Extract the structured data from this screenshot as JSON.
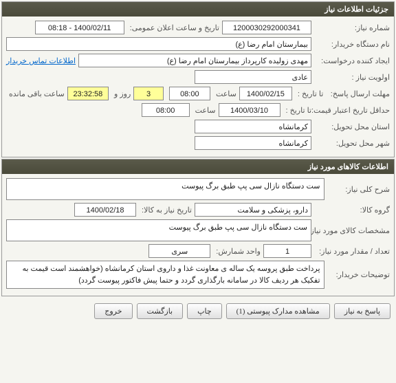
{
  "panel1": {
    "title": "جزئیات اطلاعات نیاز"
  },
  "need": {
    "number_label": "شماره نیاز:",
    "number": "1200030292000341",
    "public_date_label": "تاریخ و ساعت اعلان عمومی:",
    "public_date": "1400/02/11 - 08:18",
    "buyer_org_label": "نام دستگاه خریدار:",
    "buyer_org": "بیمارستان امام رضا (ع)",
    "requester_label": "ایجاد کننده درخواست:",
    "requester": "مهدی زولیده کارپرداز بیمارستان امام رضا (ع)",
    "contact_link": "اطلاعات تماس خریدار",
    "priority_label": "اولویت نیاز :",
    "priority": "عادی",
    "deadline_label": "مهلت ارسال پاسخ:",
    "to_date_label": "تا تاریخ :",
    "deadline_date": "1400/02/15",
    "time_label": "ساعت",
    "deadline_time": "08:00",
    "days": "3",
    "days_label": "روز و",
    "countdown": "23:32:58",
    "remaining_label": "ساعت باقی مانده",
    "validity_label": "حداقل تاریخ اعتبار قیمت:",
    "validity_date": "1400/03/10",
    "validity_time": "08:00",
    "province_label": "استان محل تحویل:",
    "province": "کرمانشاه",
    "city_label": "شهر محل تحویل:",
    "city": "کرمانشاه"
  },
  "panel2": {
    "title": "اطلاعات کالاهای مورد نیاز"
  },
  "goods": {
    "desc_label": "شرح کلی نیاز:",
    "desc": "ست دستگاه نازال سی پپ طبق برگ پیوست",
    "group_label": "گروه کالا:",
    "group": "دارو، پزشکی و سلامت",
    "need_date_label": "تاریخ نیاز به کالا:",
    "need_date": "1400/02/18",
    "spec_label": "مشخصات کالای مورد نیاز:",
    "spec": "ست دستگاه نازال سی پپ طبق برگ پیوست",
    "qty_label": "تعداد / مقدار مورد نیاز:",
    "qty": "1",
    "unit_label": "واحد شمارش:",
    "unit": "سری",
    "buyer_notes_label": "توضیحات خریدار:",
    "buyer_notes": "پرداخت طبق پروسه یک ساله ی معاونت غذا و داروی استان کرمانشاه (خواهشمند است قیمت به تفکیک هر ردیف کالا در سامانه بارگذاری گردد و حتما پیش فاکتور پیوست گردد)"
  },
  "buttons": {
    "reply": "پاسخ به نیاز",
    "attachments": "مشاهده مدارک پیوستی (1)",
    "print": "چاپ",
    "back": "بازگشت",
    "exit": "خروج"
  }
}
